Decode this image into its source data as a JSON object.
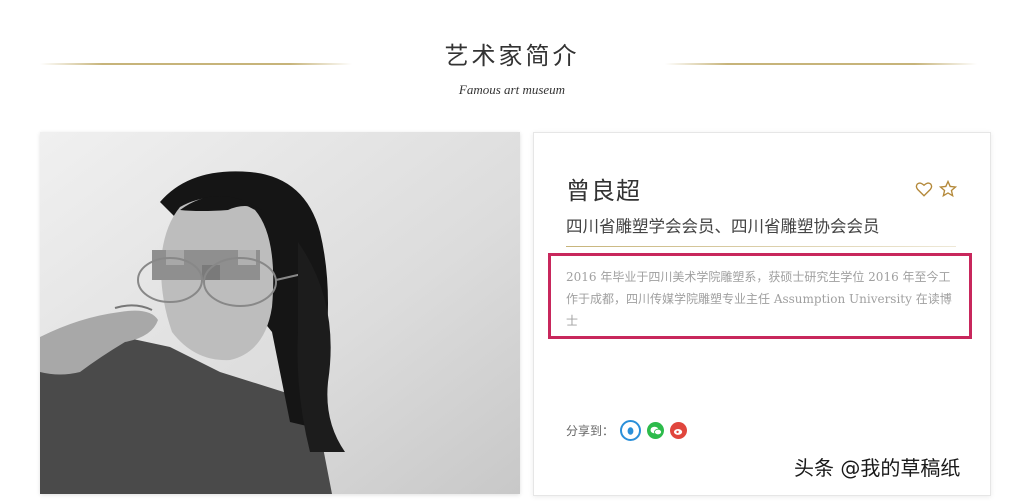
{
  "header": {
    "title": "艺术家简介",
    "subtitle": "Famous art museum"
  },
  "artist": {
    "name": "曾良超",
    "membership": "四川省雕塑学会会员、四川省雕塑协会会员",
    "bio": "2016 年毕业于四川美术学院雕塑系，获硕士研究生学位 2016 年至今工作于成都，四川传媒学院雕塑专业主任 Assumption University 在读博士"
  },
  "share": {
    "label": "分享到：",
    "icons": [
      "qq-icon",
      "wechat-icon",
      "weibo-icon"
    ],
    "colors": {
      "qq": "#2a8fd9",
      "wechat": "#2dbb4b",
      "weibo": "#e0463d"
    }
  },
  "actions": {
    "icons": [
      "heart-icon",
      "star-icon"
    ],
    "color": "#b4893a"
  },
  "highlight_color": "#c8275c",
  "accent_gold": "#c7b47a",
  "watermark": "头条 @我的草稿纸"
}
